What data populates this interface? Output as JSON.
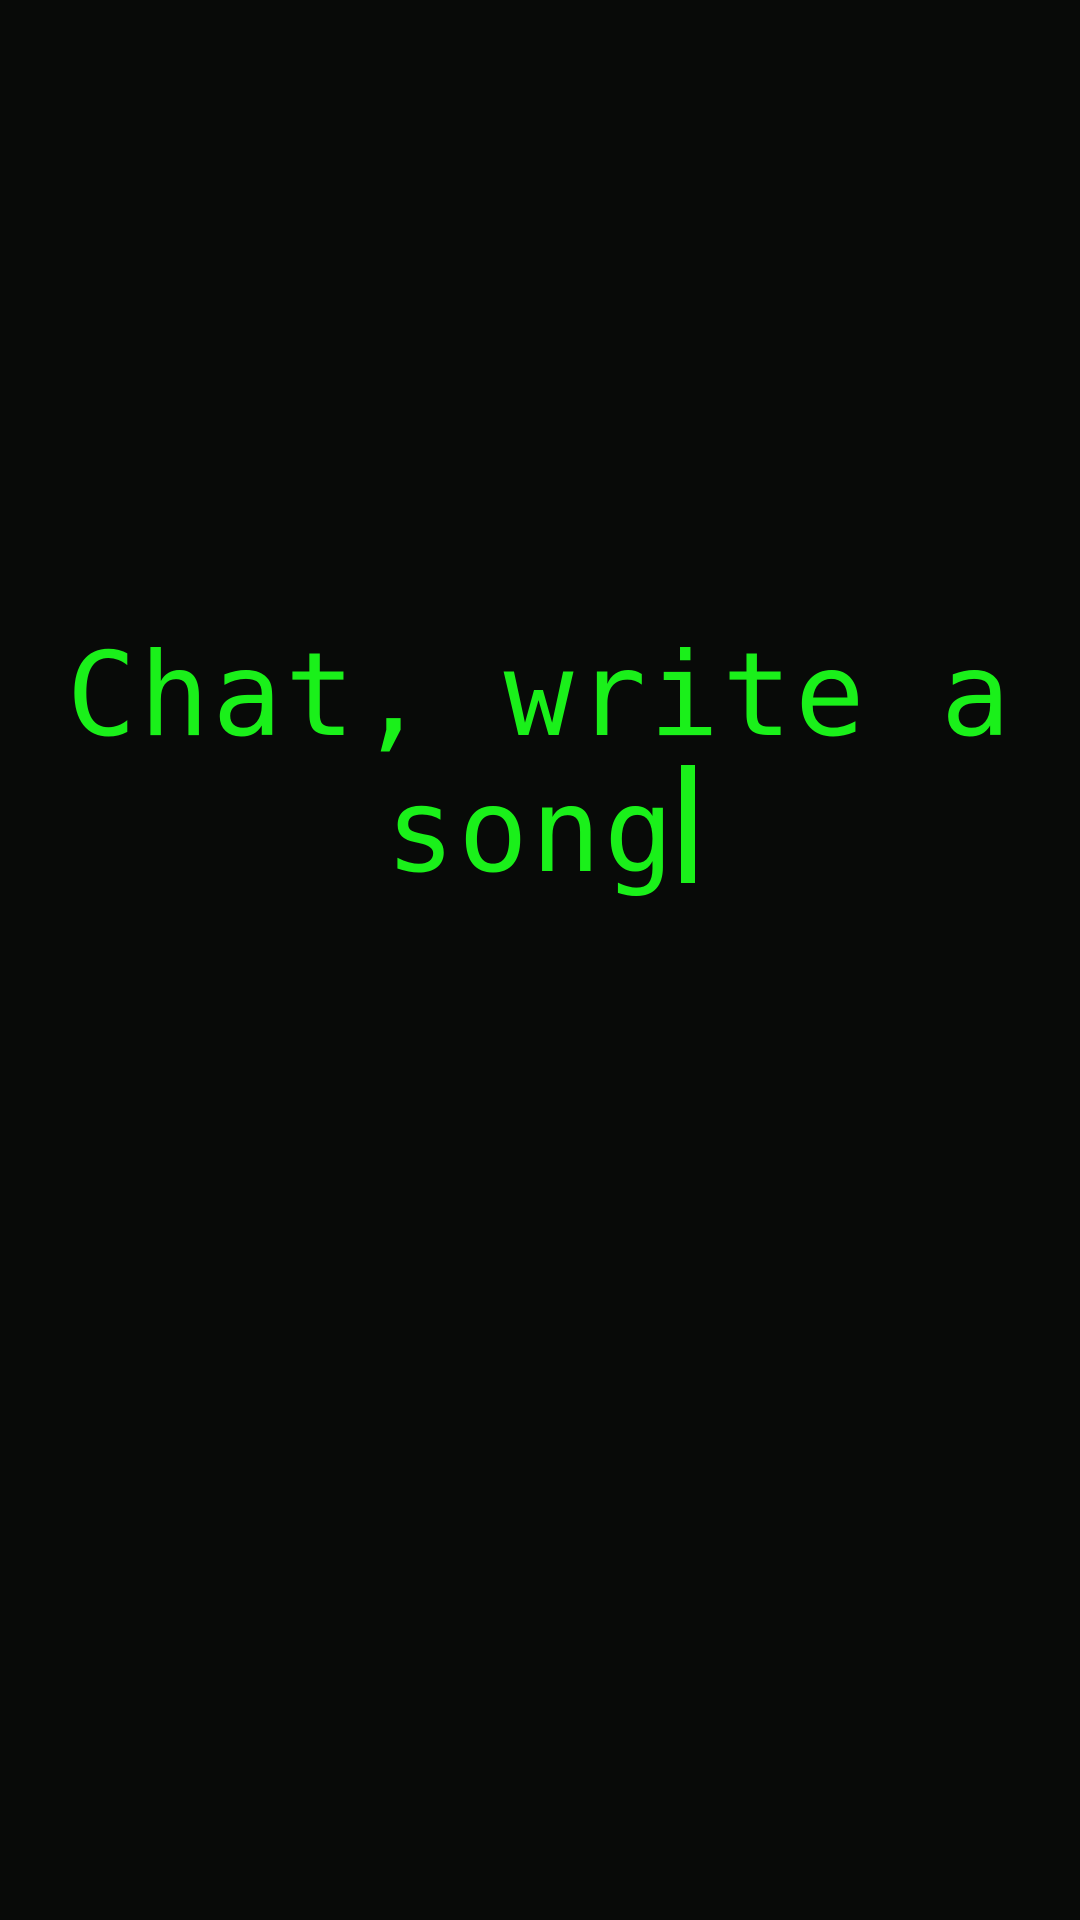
{
  "prompt": {
    "line1": "Chat, write a",
    "line2": "song"
  },
  "colors": {
    "background": "#080a08",
    "text": "#1af01a",
    "cursor": "#1af01a"
  }
}
